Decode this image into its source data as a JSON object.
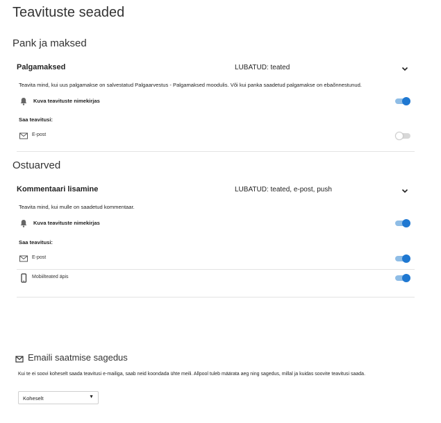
{
  "page": {
    "title": "Teavituste seaded"
  },
  "sections": [
    {
      "title": "Pank ja maksed",
      "card": {
        "name": "Palgamaksed",
        "status": "LUBATUD: teated",
        "description": "Teavita mind, kui uus palgamakse on salvestatud Palgaarvestus - Palgamaksed moodulis. Või kui panka saadetud palgamakse on ebaõnnestunud.",
        "show_in_list_label": "Kuva teavituste nimekirjas",
        "show_in_list_on": true,
        "receive_label": "Saa teavitusi:",
        "channels": [
          {
            "label": "E-post",
            "icon": "envelope-icon",
            "on": false
          }
        ]
      }
    },
    {
      "title": "Ostuarved",
      "card": {
        "name": "Kommentaari lisamine",
        "status": "LUBATUD: teated, e-post, push",
        "description": "Teavita mind, kui mulle on saadetud kommentaar.",
        "show_in_list_label": "Kuva teavituste nimekirjas",
        "show_in_list_on": true,
        "receive_label": "Saa teavitusi:",
        "channels": [
          {
            "label": "E-post",
            "icon": "envelope-icon",
            "on": true
          },
          {
            "label": "Mobiilteated äpis",
            "icon": "mobile-phone-icon",
            "on": true
          }
        ]
      }
    }
  ],
  "email_frequency": {
    "title": "Emaili saatmise sagedus",
    "description": "Kui te ei soovi koheselt saada teavitusi e-mailiga, saab neid koondada ühte meili. Allpool tuleb määrata aeg ning sagedus, millal ja kuidas soovite teavitusi saada.",
    "selected": "Koheselt"
  },
  "colors": {
    "toggle_on_knob": "#1f78d1",
    "toggle_on_track": "#8fbde6",
    "toggle_off_track": "#d8d8d8"
  }
}
